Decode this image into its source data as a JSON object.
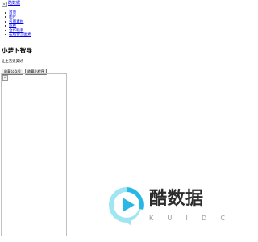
{
  "header": {
    "logo_alt": "酷数据",
    "logo_text": "酷数据"
  },
  "nav": {
    "items": [
      {
        "label": "首页"
      },
      {
        "label": "图片"
      },
      {
        "label": "名图素材"
      },
      {
        "label": "影视"
      },
      {
        "label": "合作联系"
      },
      {
        "label": "在线留言图素"
      }
    ]
  },
  "site": {
    "title": "小萝卜智导",
    "tagline": "让生活更美好"
  },
  "buttons": [
    {
      "label": "收藏公众号"
    },
    {
      "label": "收藏小程序"
    }
  ],
  "watermark": {
    "title": "酷数据",
    "letters": [
      "K",
      "U",
      "I",
      "D",
      "C"
    ],
    "colors": {
      "accent_light": "#9fe6f2",
      "accent": "#29b7e6",
      "text": "#2c2c2c",
      "subtext": "#9a9a9a"
    }
  }
}
